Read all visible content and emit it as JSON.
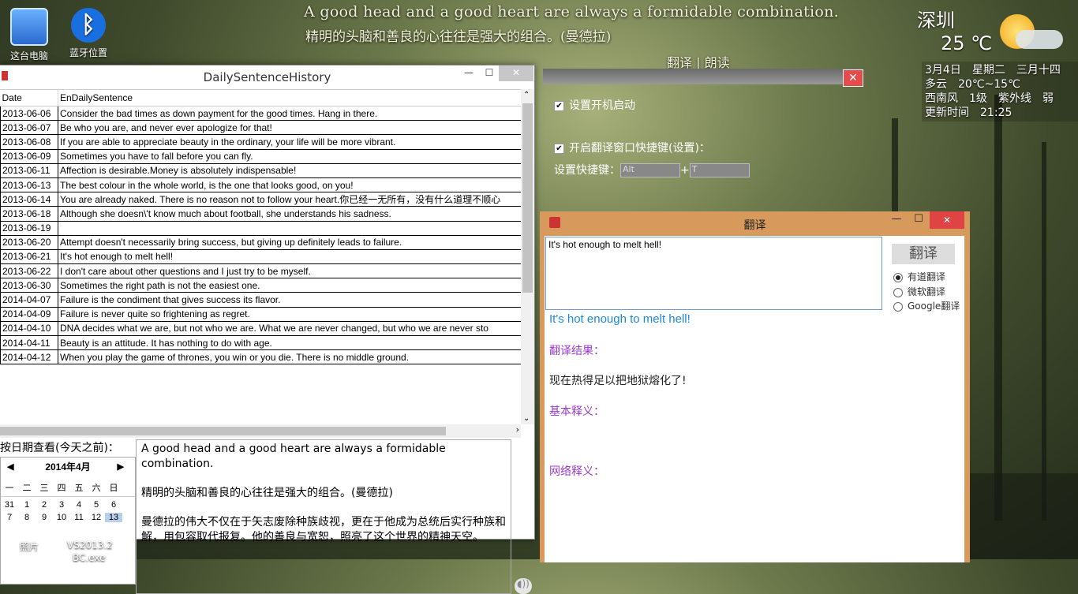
{
  "desktop": {
    "icons": [
      {
        "label": "这台电脑",
        "icon": "computer-icon"
      },
      {
        "label": "蓝牙位置",
        "icon": "bluetooth-icon"
      }
    ],
    "taskbar_labels": [
      "照片",
      "VS2013.2",
      "BC.exe"
    ]
  },
  "quote_banner": {
    "en": "A good head and a good heart are always a formidable combination.",
    "cn": "精明的头脑和善良的心往往是强大的组合。(曼德拉)",
    "translate_link": "翻译",
    "separator": "|",
    "read_link": "朗读"
  },
  "weather": {
    "city": "深圳",
    "temperature": "25 ℃",
    "date_line": "3月4日　星期二　三月十四",
    "condition_line": "多云　20℃~15℃",
    "wind_line": "西南风　1级　紫外线　弱",
    "update_line": "更新时间　21:25"
  },
  "history_window": {
    "title": "DailySentenceHistory",
    "columns": [
      "Date",
      "EnDailySentence"
    ],
    "rows": [
      [
        "2013-06-06",
        "Consider the bad times as down payment for the good times. Hang in there."
      ],
      [
        "2013-06-07",
        "Be who you are, and never ever apologize for that!"
      ],
      [
        "2013-06-08",
        "If you are able to appreciate beauty in the ordinary, your life will be more vibrant."
      ],
      [
        "2013-06-09",
        "Sometimes you have to fall before you can fly."
      ],
      [
        "2013-06-11",
        "Affection is desirable.Money is absolutely indispensable!"
      ],
      [
        "2013-06-13",
        "The best colour in the whole world, is the one that looks good, on you!"
      ],
      [
        "2013-06-14",
        "You are already naked. There is no reason not to follow your heart.你已经一无所有，没有什么道理不顺心"
      ],
      [
        "2013-06-18",
        "Although she doesn\\'t know much about football, she understands his sadness."
      ],
      [
        "2013-06-19",
        ""
      ],
      [
        "2013-06-20",
        "Attempt doesn't necessarily bring success, but giving up definitely leads to failure."
      ],
      [
        "2013-06-21",
        "It's hot enough to melt hell!"
      ],
      [
        "2013-06-22",
        "I don't care about other questions and I just try to be myself."
      ],
      [
        "2013-06-30",
        "Sometimes the right path is not the easiest one."
      ],
      [
        "2014-04-07",
        "Failure is the condiment that gives success its flavor."
      ],
      [
        "2014-04-09",
        "Failure is never quite so frightening as regret."
      ],
      [
        "2014-04-10",
        "DNA decides what we are, but not who we are. What we are never changed, but who we are never sto"
      ],
      [
        "2014-04-11",
        "Beauty is an attitude. It has nothing to do with age."
      ],
      [
        "2014-04-12",
        "When you play the game of thrones, you win or you die. There is no middle ground."
      ]
    ],
    "calendar_label": "按日期查看(今天之前)：",
    "calendar": {
      "month": "2014年4月",
      "weekdays": [
        "一",
        "二",
        "三",
        "四",
        "五",
        "六",
        "日"
      ],
      "weeks": [
        [
          "31",
          "1",
          "2",
          "3",
          "4",
          "5",
          "6"
        ],
        [
          "7",
          "8",
          "9",
          "10",
          "11",
          "12",
          "13"
        ]
      ],
      "selected": "13"
    },
    "sentence_en": "A good head and a good heart are always a formidable combination.",
    "sentence_cn": "精明的头脑和善良的心往往是强大的组合。(曼德拉)",
    "sentence_note": "曼德拉的伟大不仅在于矢志废除种族歧视，更在于他成为总统后实行种族和解，用包容取代报复。他的善良与宽恕，照亮了这个世界的精神天空。"
  },
  "settings_panel": {
    "autostart_label": "设置开机启动",
    "hotkey_enable_label": "开启翻译窗口快捷键(设置)：",
    "hotkey_label": "设置快捷键：",
    "modifier_value": "Alt",
    "plus": "+",
    "key_value": "T"
  },
  "translate_window": {
    "title": "翻译",
    "input_text": "It's hot enough to melt hell!",
    "translate_button": "翻译",
    "engines": [
      "有道翻译",
      "微软翻译",
      "Google翻译"
    ],
    "selected_engine": "有道翻译",
    "source_echo": "It's hot enough to melt hell!",
    "result_label": "翻译结果：",
    "result_text": "现在热得足以把地狱熔化了!",
    "basic_label": "基本释义：",
    "web_label": "网络释义："
  },
  "colors": {
    "close_red": "#e04343",
    "translate_frame": "#d79a5c",
    "link_blue": "#1e88d8",
    "label_purple": "#9b3ad0"
  }
}
